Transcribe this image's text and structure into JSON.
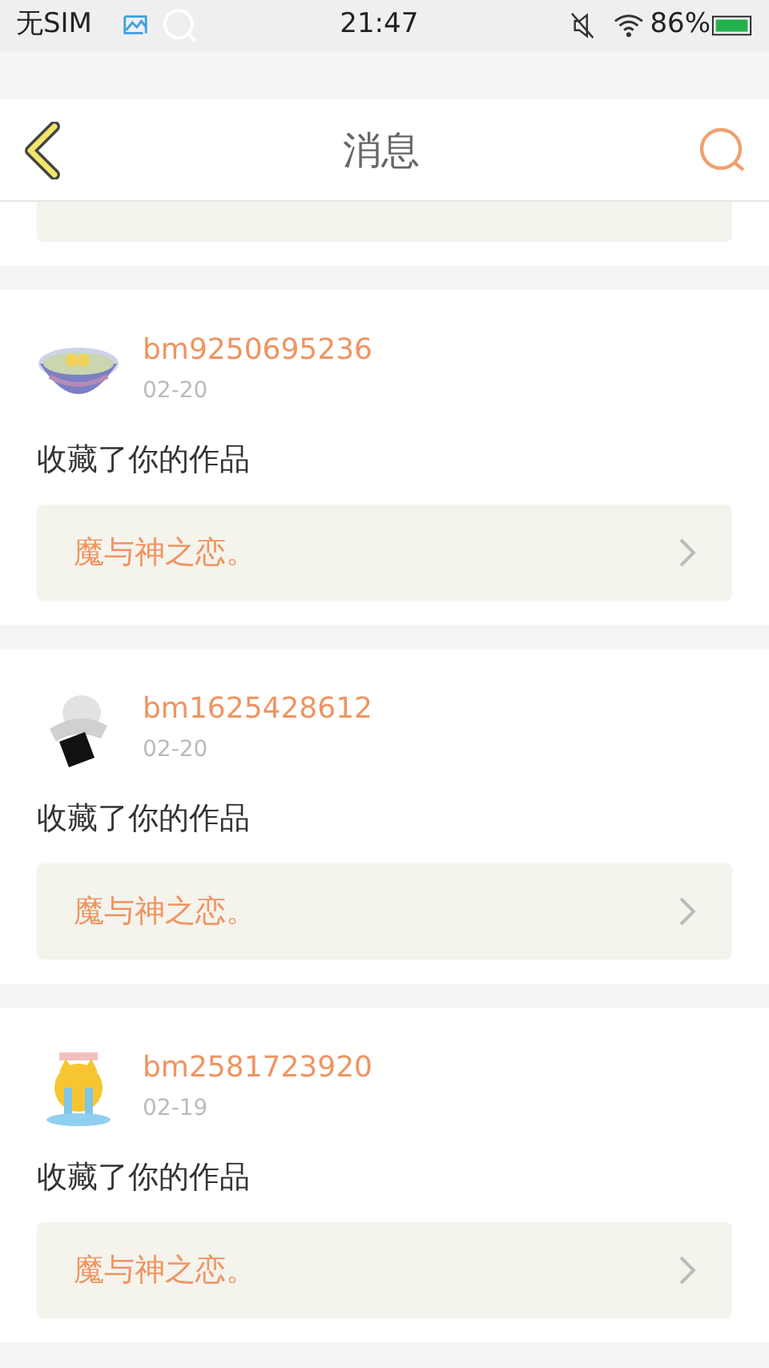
{
  "status_bar": {
    "carrier": "无SIM",
    "time": "21:47",
    "battery": "86%"
  },
  "header": {
    "title": "消息"
  },
  "messages": [
    {
      "user": "bm9250695236",
      "date": "02-20",
      "action": "收藏了你的作品",
      "work": "魔与神之恋。"
    },
    {
      "user": "bm1625428612",
      "date": "02-20",
      "action": "收藏了你的作品",
      "work": "魔与神之恋。"
    },
    {
      "user": "bm2581723920",
      "date": "02-19",
      "action": "收藏了你的作品",
      "work": "魔与神之恋。"
    }
  ]
}
